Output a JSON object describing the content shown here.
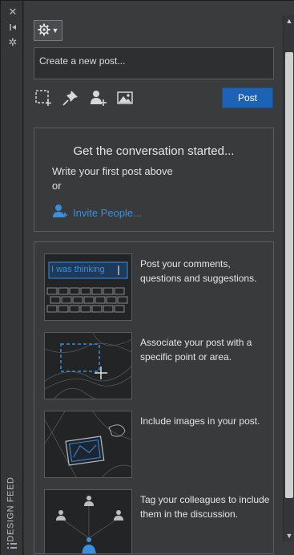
{
  "window": {
    "vertical_title": "DESIGN FEED"
  },
  "icons": {
    "close": "close-icon",
    "dock": "dock-icon",
    "settings_small": "settings-icon",
    "gear": "gear-icon",
    "select_area": "select-area-icon",
    "pin": "pin-icon",
    "add_user": "add-user-icon",
    "image": "image-icon",
    "invite_person": "person-add-icon",
    "list": "list-icon"
  },
  "composer": {
    "placeholder": "Create a new post...",
    "post_label": "Post"
  },
  "empty_state": {
    "title": "Get the conversation started...",
    "subtitle": "Write your first post above",
    "or": "or",
    "invite_label": "Invite People..."
  },
  "tips": [
    {
      "image_caption": "I was thinking",
      "text": "Post your comments, questions and suggestions."
    },
    {
      "text": "Associate your post with a specific point or area."
    },
    {
      "text": "Include images in your post."
    },
    {
      "text": "Tag your colleagues to include them in the discussion."
    }
  ],
  "colors": {
    "accent": "#1c63b6",
    "link": "#3a8fdc",
    "background": "#3a3b3d"
  }
}
